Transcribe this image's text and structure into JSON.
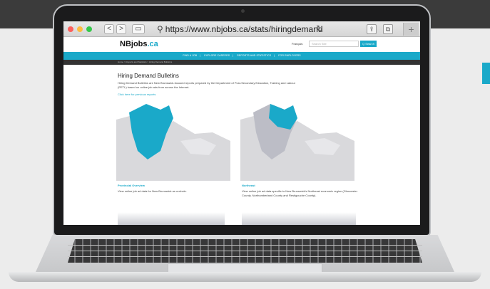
{
  "browser": {
    "url": "https://www.nbjobs.ca/stats/hiringdemand",
    "back": "<",
    "forward": ">",
    "new_tab": "+"
  },
  "site": {
    "logo": "NBjobs",
    "logo_suffix": ".ca",
    "language_link": "Français",
    "search_placeholder": "Search Site",
    "search_button": "Q Search",
    "nav": [
      "FIND A JOB",
      "EXPLORE CAREERS",
      "REPORTS AND STATISTICS",
      "FOR EMPLOYERS"
    ],
    "breadcrumb": "Home > Reports and Statistics > Hiring Demand Bulletins"
  },
  "page": {
    "title": "Hiring Demand Bulletins",
    "intro": "Hiring Demand Bulletins are New Brunswick-focused reports prepared by the Department of Post-Secondary Education, Training and Labour (PETL) based on online job ads from across the Internet.",
    "previous_link": "Click here for previous reports",
    "cards": [
      {
        "title": "Provincial Overview",
        "description": "View online job ad data for New Brunswick as a whole."
      },
      {
        "title": "Northeast",
        "description": "View online job ad data specific to New Brunswick's Northeast economic region (Gloucester County, Northumberland County and Restigouche County)."
      }
    ]
  },
  "colors": {
    "accent": "#1aa9c9",
    "land": "#d9d9dc",
    "province_muted": "#bcbdc6"
  }
}
